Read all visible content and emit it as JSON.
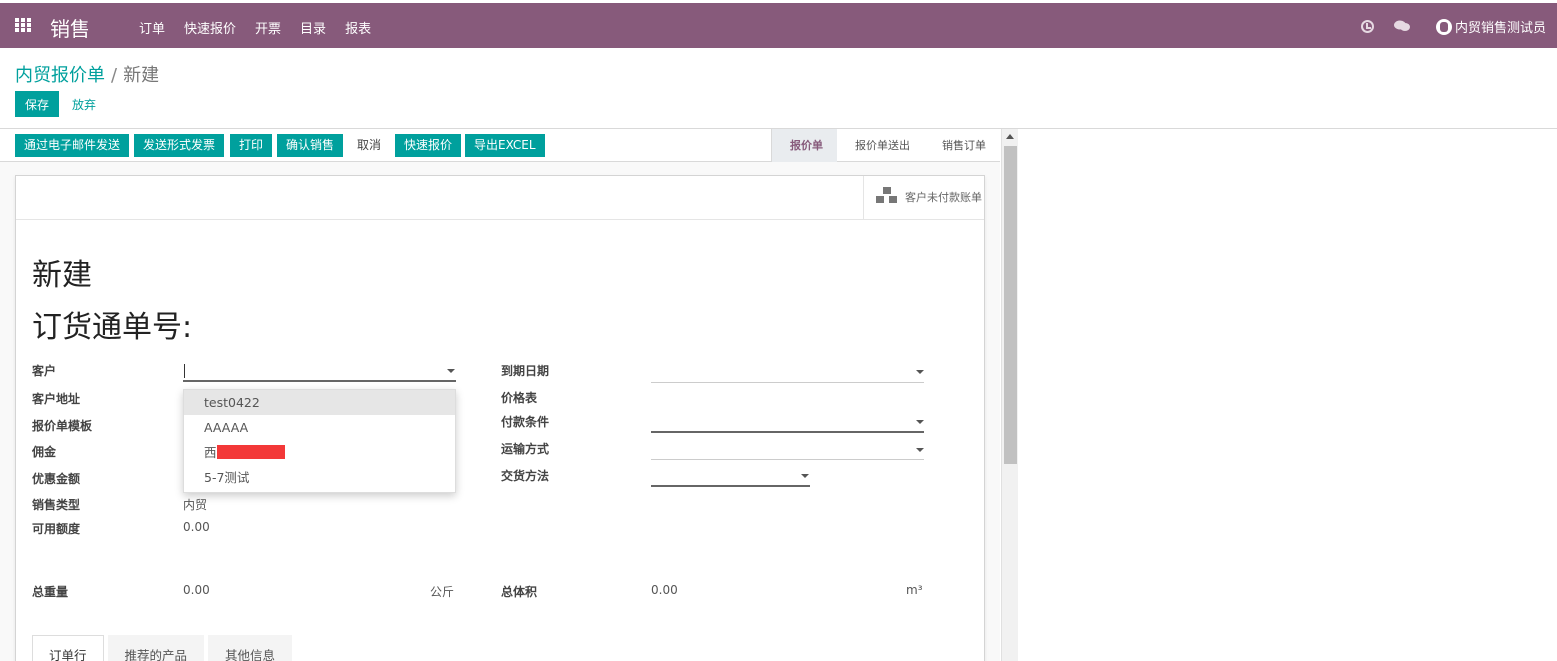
{
  "topbar": {
    "app_title": "销售",
    "menu": [
      "订单",
      "快速报价",
      "开票",
      "目录",
      "报表"
    ],
    "user_name": "内贸销售测试员"
  },
  "breadcrumb": {
    "parent": "内贸报价单",
    "separator": "/",
    "current": "新建"
  },
  "control": {
    "save_label": "保存",
    "discard_label": "放弃"
  },
  "statusbar": {
    "buttons": [
      "通过电子邮件发送",
      "发送形式发票",
      "打印",
      "确认销售",
      "取消",
      "快速报价",
      "导出EXCEL"
    ],
    "stages": [
      "报价单",
      "报价单送出",
      "销售订单"
    ],
    "active_stage": "报价单"
  },
  "stat_button": {
    "label": "客户未付款账单"
  },
  "sheet": {
    "title": "新建",
    "subtitle": "订货通单号:"
  },
  "left_fields": {
    "customer": "客户",
    "customer_address": "客户地址",
    "quote_template": "报价单模板",
    "commission": "佣金",
    "discount_amount": "优惠金额",
    "sales_type": "销售类型",
    "sales_type_value": "内贸",
    "available_credit": "可用额度",
    "available_credit_value": "0.00",
    "total_weight": "总重量",
    "total_weight_value": "0.00",
    "total_weight_unit": "公斤"
  },
  "right_fields": {
    "due_date": "到期日期",
    "pricelist": "价格表",
    "payment_terms": "付款条件",
    "shipping_method": "运输方式",
    "delivery_method": "交货方法",
    "total_volume": "总体积",
    "total_volume_value": "0.00",
    "total_volume_unit": "m³"
  },
  "customer_dropdown": {
    "items": [
      "test0422",
      "AAAAA",
      "西",
      "5-7测试"
    ],
    "highlighted": "test0422"
  },
  "tabs": [
    "订单行",
    "推荐的产品",
    "其他信息"
  ],
  "active_tab": "订单行",
  "colors": {
    "brand": "#875a7b",
    "primary": "#00a09d"
  }
}
